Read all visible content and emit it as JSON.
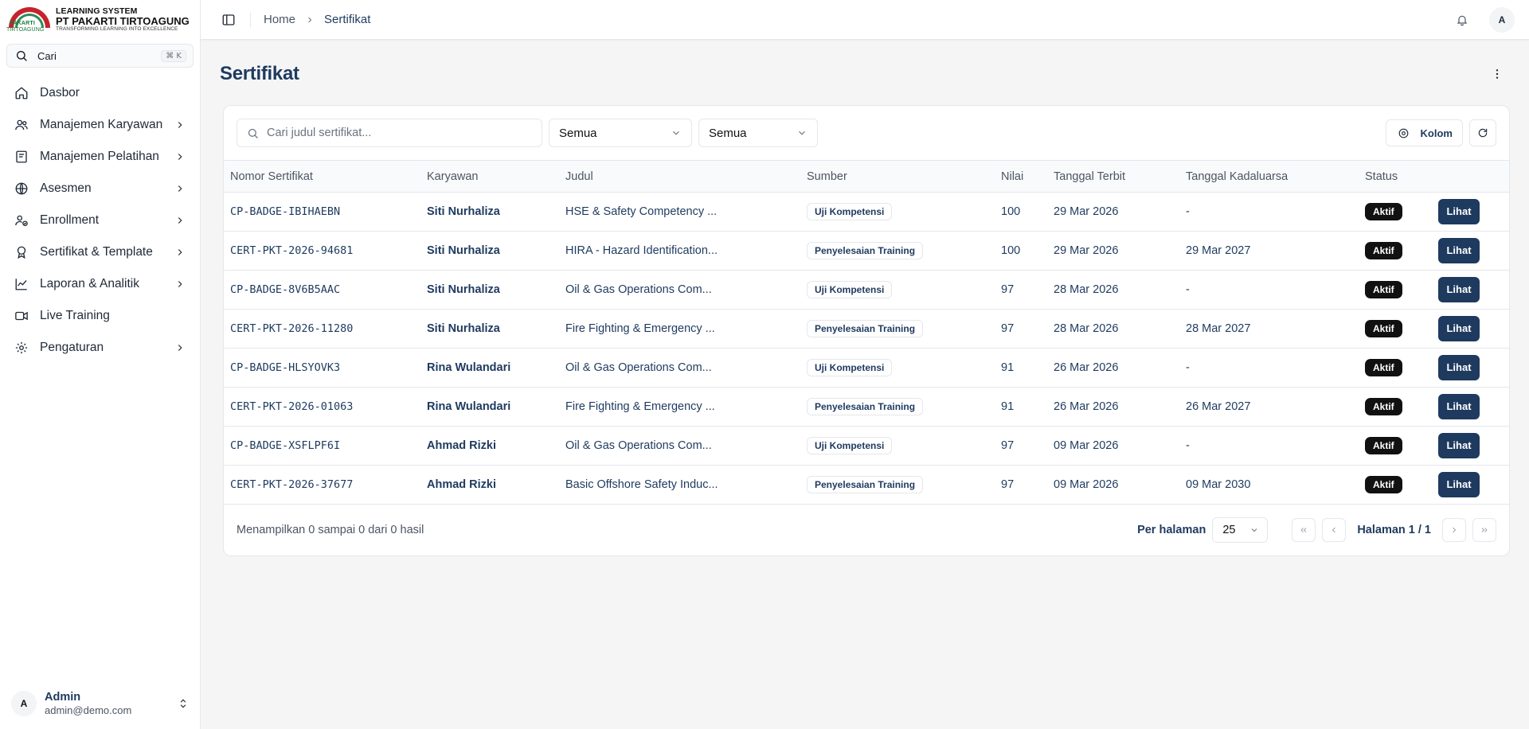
{
  "brand": {
    "line1": "LEARNING SYSTEM",
    "line2": "PT PAKARTI TIRTOAGUNG",
    "line3": "TRANSFORMING LEARNING INTO EXCELLENCE",
    "mark_text_top": "PAKARTI",
    "mark_text_bottom": "TIRTOAGUNG",
    "colors": {
      "red": "#c5232d",
      "green": "#2e8b57"
    }
  },
  "sidebar": {
    "search_placeholder": "Cari",
    "search_shortcut": "⌘ K",
    "items": [
      {
        "label": "Dasbor",
        "icon": "home-icon",
        "has_chevron": false
      },
      {
        "label": "Manajemen Karyawan",
        "icon": "users-icon",
        "has_chevron": true
      },
      {
        "label": "Manajemen Pelatihan",
        "icon": "book-icon",
        "has_chevron": true
      },
      {
        "label": "Asesmen",
        "icon": "globe-icon",
        "has_chevron": true
      },
      {
        "label": "Enrollment",
        "icon": "user-check-icon",
        "has_chevron": true
      },
      {
        "label": "Sertifikat & Template",
        "icon": "award-icon",
        "has_chevron": true
      },
      {
        "label": "Laporan & Analitik",
        "icon": "chart-line-icon",
        "has_chevron": true
      },
      {
        "label": "Live Training",
        "icon": "video-icon",
        "has_chevron": false
      },
      {
        "label": "Pengaturan",
        "icon": "gear-icon",
        "has_chevron": true
      }
    ],
    "user": {
      "initial": "A",
      "name": "Admin",
      "email": "admin@demo.com"
    }
  },
  "topbar": {
    "breadcrumb": {
      "home": "Home",
      "current": "Sertifikat"
    },
    "avatar_initial": "A"
  },
  "page": {
    "title": "Sertifikat"
  },
  "toolbar": {
    "search_placeholder": "Cari judul sertifikat...",
    "filter1": "Semua",
    "filter2": "Semua",
    "columns_label": "Kolom"
  },
  "table": {
    "headers": [
      "Nomor Sertifikat",
      "Karyawan",
      "Judul",
      "Sumber",
      "Nilai",
      "Tanggal Terbit",
      "Tanggal Kadaluarsa",
      "Status",
      ""
    ],
    "action_label": "Lihat",
    "rows": [
      {
        "number": "CP-BADGE-IBIHAEBN",
        "employee": "Siti Nurhaliza",
        "title": "HSE & Safety Competency ...",
        "source": "Uji Kompetensi",
        "score": "100",
        "issued": "29 Mar 2026",
        "expires": "-",
        "status": "Aktif"
      },
      {
        "number": "CERT-PKT-2026-94681",
        "employee": "Siti Nurhaliza",
        "title": "HIRA - Hazard Identification...",
        "source": "Penyelesaian Training",
        "score": "100",
        "issued": "29 Mar 2026",
        "expires": "29 Mar 2027",
        "status": "Aktif"
      },
      {
        "number": "CP-BADGE-8V6B5AAC",
        "employee": "Siti Nurhaliza",
        "title": "Oil & Gas Operations Com...",
        "source": "Uji Kompetensi",
        "score": "97",
        "issued": "28 Mar 2026",
        "expires": "-",
        "status": "Aktif"
      },
      {
        "number": "CERT-PKT-2026-11280",
        "employee": "Siti Nurhaliza",
        "title": "Fire Fighting & Emergency ...",
        "source": "Penyelesaian Training",
        "score": "97",
        "issued": "28 Mar 2026",
        "expires": "28 Mar 2027",
        "status": "Aktif"
      },
      {
        "number": "CP-BADGE-HLSYOVK3",
        "employee": "Rina Wulandari",
        "title": "Oil & Gas Operations Com...",
        "source": "Uji Kompetensi",
        "score": "91",
        "issued": "26 Mar 2026",
        "expires": "-",
        "status": "Aktif"
      },
      {
        "number": "CERT-PKT-2026-01063",
        "employee": "Rina Wulandari",
        "title": "Fire Fighting & Emergency ...",
        "source": "Penyelesaian Training",
        "score": "91",
        "issued": "26 Mar 2026",
        "expires": "26 Mar 2027",
        "status": "Aktif"
      },
      {
        "number": "CP-BADGE-XSFLPF6I",
        "employee": "Ahmad Rizki",
        "title": "Oil & Gas Operations Com...",
        "source": "Uji Kompetensi",
        "score": "97",
        "issued": "09 Mar 2026",
        "expires": "-",
        "status": "Aktif"
      },
      {
        "number": "CERT-PKT-2026-37677",
        "employee": "Ahmad Rizki",
        "title": "Basic Offshore Safety Induc...",
        "source": "Penyelesaian Training",
        "score": "97",
        "issued": "09 Mar 2026",
        "expires": "09 Mar 2030",
        "status": "Aktif"
      }
    ]
  },
  "pagination": {
    "summary": "Menampilkan 0 sampai 0 dari 0 hasil",
    "per_page_label": "Per halaman",
    "per_page_value": "25",
    "page_text": "Halaman 1 / 1"
  }
}
